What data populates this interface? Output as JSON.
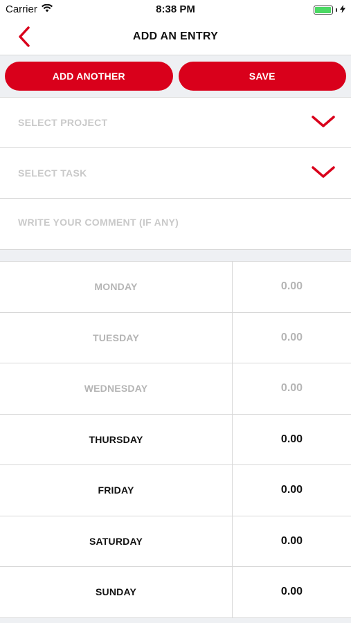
{
  "status_bar": {
    "carrier": "Carrier",
    "time": "8:38 PM",
    "battery_level": 0.95
  },
  "nav": {
    "title": "ADD AN ENTRY",
    "back_icon": "chevron-left-icon"
  },
  "buttons": {
    "add_another": "ADD ANOTHER",
    "save": "SAVE"
  },
  "form": {
    "project_placeholder": "SELECT PROJECT",
    "task_placeholder": "SELECT TASK",
    "comment_placeholder": "WRITE YOUR COMMENT (IF ANY)",
    "comment_value": ""
  },
  "days": [
    {
      "label": "MONDAY",
      "value": "0.00",
      "enabled": false
    },
    {
      "label": "TUESDAY",
      "value": "0.00",
      "enabled": false
    },
    {
      "label": "WEDNESDAY",
      "value": "0.00",
      "enabled": false
    },
    {
      "label": "THURSDAY",
      "value": "0.00",
      "enabled": true
    },
    {
      "label": "FRIDAY",
      "value": "0.00",
      "enabled": true
    },
    {
      "label": "SATURDAY",
      "value": "0.00",
      "enabled": true
    },
    {
      "label": "SUNDAY",
      "value": "0.00",
      "enabled": true
    }
  ],
  "colors": {
    "accent": "#d9001b",
    "divider": "#d8d8d8",
    "strip_background": "#eef0f3",
    "placeholder": "#c9c9c9"
  }
}
